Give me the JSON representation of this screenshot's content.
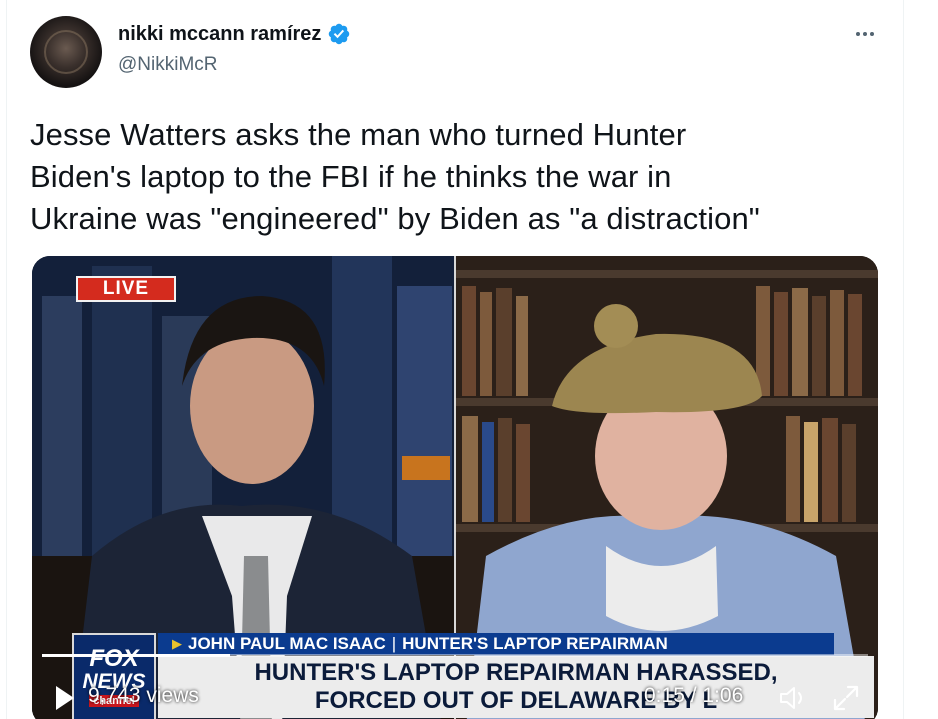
{
  "author": {
    "display_name": "nikki mccann ramírez",
    "handle": "@NikkiMcR",
    "verified_icon": "verified-badge-icon",
    "avatar_icon": "avatar-image"
  },
  "tweet": {
    "text": "Jesse Watters asks the man who turned Hunter\nBiden's laptop to the FBI if he thinks the war in\nUkraine was \"engineered\" by Biden as \"a distraction\""
  },
  "more_icon": "more-options-icon",
  "video": {
    "live_badge": "LIVE",
    "network_logo_line1": "FOX",
    "network_logo_line2": "NEWS",
    "network_logo_line3": "channel",
    "name_strap_name": "JOHN PAUL MAC ISAAC",
    "name_strap_separator": "|",
    "name_strap_title": "HUNTER'S LAPTOP REPAIRMAN",
    "headline_line1": "HUNTER'S LAPTOP REPAIRMAN HARASSED,",
    "headline_line2": "FORCED OUT OF DELAWARE BY L",
    "views": "9,743 views",
    "timecode": "0:15 / 1:06",
    "progress_fraction": 0.227,
    "play_icon": "play-icon",
    "volume_icon": "volume-icon",
    "fullscreen_icon": "fullscreen-icon"
  },
  "colors": {
    "verified_blue": "#1d9bf0",
    "live_red": "#d42b1e",
    "strap_blue": "#0b3b8f"
  }
}
